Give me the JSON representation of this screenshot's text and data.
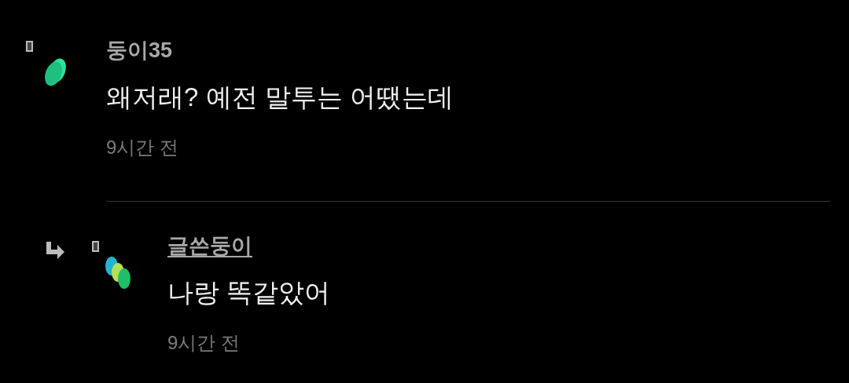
{
  "comments": [
    {
      "kind": "comment",
      "author": "둥이35",
      "text": "왜저래? 예전 말투는 어땠는데",
      "time": "9시간 전"
    },
    {
      "kind": "reply",
      "author": "글쓴둥이",
      "text": "나랑 똑같았어",
      "time": "9시간 전"
    }
  ]
}
